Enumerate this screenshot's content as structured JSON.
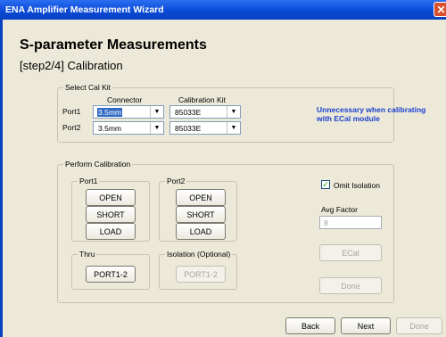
{
  "window": {
    "title": "ENA Amplifier Measurement Wizard",
    "close_glyph": "✕"
  },
  "heading": "S-parameter Measurements",
  "subheading": "[step2/4] Calibration",
  "cal_kit": {
    "legend": "Select Cal Kit",
    "connector_header": "Connector",
    "kit_header": "Calibration Kit",
    "port1_label": "Port1",
    "port2_label": "Port2",
    "port1_connector": "3.5mm",
    "port2_connector": "3.5mm",
    "port1_kit": "85033E",
    "port2_kit": "85033E",
    "note": "Unnecessary when calibrating with ECal module"
  },
  "perform": {
    "legend": "Perform Calibration",
    "port1": {
      "legend": "Port1",
      "open": "OPEN",
      "short": "SHORT",
      "load": "LOAD"
    },
    "port2": {
      "legend": "Port2",
      "open": "OPEN",
      "short": "SHORT",
      "load": "LOAD"
    },
    "thru": {
      "legend": "Thru",
      "button": "PORT1-2"
    },
    "isolation": {
      "legend": "Isolation (Optional)",
      "button": "PORT1-2"
    },
    "omit_isolation_label": "Omit Isolation",
    "omit_isolation_checked": true,
    "avg_factor_label": "Avg Factor",
    "avg_factor_value": "8",
    "ecal_button": "ECal",
    "done_button": "Done"
  },
  "footer": {
    "back": "Back",
    "next": "Next",
    "done": "Done"
  },
  "colors": {
    "titlebar": "#0a4ad8",
    "note_text": "#1a3fd0",
    "background": "#ece9d8"
  }
}
